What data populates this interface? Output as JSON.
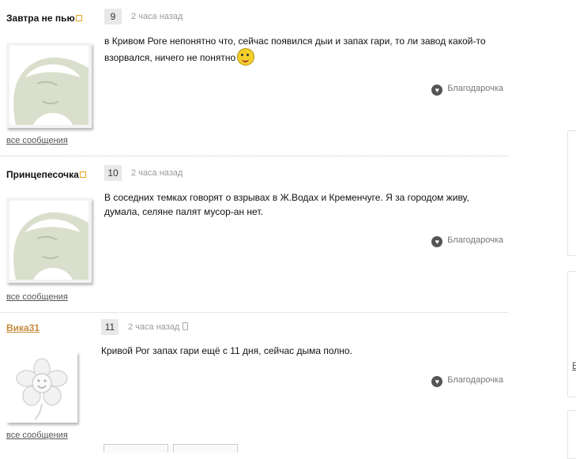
{
  "posts": [
    {
      "author": "Завтра не пью",
      "number": "9",
      "time": "2 часа назад",
      "text": "в Кривом Роге непонятно что, сейчас появился дыи и запах гари, то ли завод какой-то взорвался, ничего не понятно",
      "thanks": "Благодарочка",
      "all_messages": "все сообщения",
      "avatar": "lady-with-hat-avatar"
    },
    {
      "author": "Принцепесочка",
      "number": "10",
      "time": "2 часа назад",
      "text": "В соседних темках говорят о взрывах в Ж.Водах и Кременчуге. Я за городом живу, думала, селяне палят мусор-ан нет.",
      "thanks": "Благодарочка",
      "all_messages": "все сообщения",
      "avatar": "lady-with-hat-avatar"
    },
    {
      "author": "Вика31",
      "number": "11",
      "time": "2 часа назад",
      "text": "Кривой Рог запах гари ещё с 11 дня, сейчас дыма полно.",
      "thanks": "Благодарочка",
      "all_messages": "все сообщения",
      "avatar": "flower-avatar"
    }
  ],
  "sidebar": {
    "partial_letter": "Е"
  },
  "colors": {
    "link_author": "#c58a3c",
    "online_dot": "#e6a21c",
    "avatar_bg": "#d9dfcc"
  }
}
